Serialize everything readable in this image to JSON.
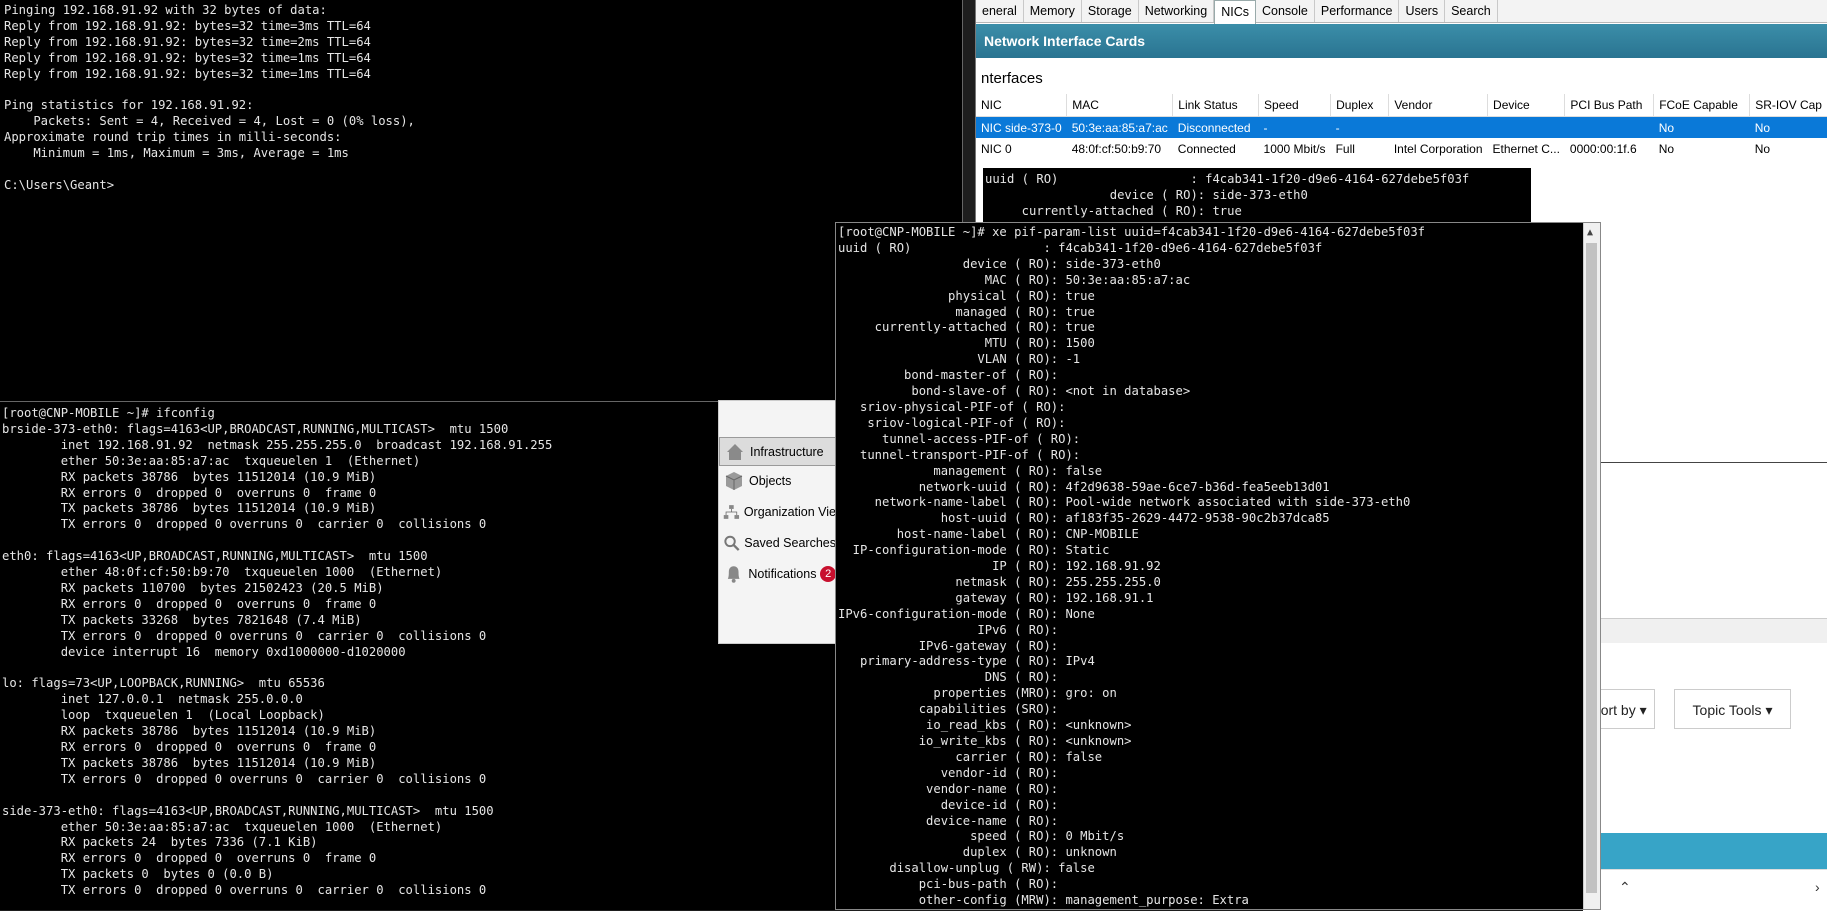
{
  "ping_terminal": {
    "lines": [
      "Pinging 192.168.91.92 with 32 bytes of data:",
      "Reply from 192.168.91.92: bytes=32 time=3ms TTL=64",
      "Reply from 192.168.91.92: bytes=32 time=2ms TTL=64",
      "Reply from 192.168.91.92: bytes=32 time=1ms TTL=64",
      "Reply from 192.168.91.92: bytes=32 time=1ms TTL=64",
      "",
      "Ping statistics for 192.168.91.92:",
      "    Packets: Sent = 4, Received = 4, Lost = 0 (0% loss),",
      "Approximate round trip times in milli-seconds:",
      "    Minimum = 1ms, Maximum = 3ms, Average = 1ms",
      "",
      "C:\\Users\\Geant>"
    ]
  },
  "ifconfig_terminal": {
    "lines": [
      "[root@CNP-MOBILE ~]# ifconfig",
      "brside-373-eth0: flags=4163<UP,BROADCAST,RUNNING,MULTICAST>  mtu 1500",
      "        inet 192.168.91.92  netmask 255.255.255.0  broadcast 192.168.91.255",
      "        ether 50:3e:aa:85:a7:ac  txqueuelen 1  (Ethernet)",
      "        RX packets 38786  bytes 11512014 (10.9 MiB)",
      "        RX errors 0  dropped 0  overruns 0  frame 0",
      "        TX packets 38786  bytes 11512014 (10.9 MiB)",
      "        TX errors 0  dropped 0 overruns 0  carrier 0  collisions 0",
      "",
      "eth0: flags=4163<UP,BROADCAST,RUNNING,MULTICAST>  mtu 1500",
      "        ether 48:0f:cf:50:b9:70  txqueuelen 1000  (Ethernet)",
      "        RX packets 110700  bytes 21502423 (20.5 MiB)",
      "        RX errors 0  dropped 0  overruns 0  frame 0",
      "        TX packets 33268  bytes 7821648 (7.4 MiB)",
      "        TX errors 0  dropped 0 overruns 0  carrier 0  collisions 0",
      "        device interrupt 16  memory 0xd1000000-d1020000",
      "",
      "lo: flags=73<UP,LOOPBACK,RUNNING>  mtu 65536",
      "        inet 127.0.0.1  netmask 255.0.0.0",
      "        loop  txqueuelen 1  (Local Loopback)",
      "        RX packets 38786  bytes 11512014 (10.9 MiB)",
      "        RX errors 0  dropped 0  overruns 0  frame 0",
      "        TX packets 38786  bytes 11512014 (10.9 MiB)",
      "        TX errors 0  dropped 0 overruns 0  carrier 0  collisions 0",
      "",
      "side-373-eth0: flags=4163<UP,BROADCAST,RUNNING,MULTICAST>  mtu 1500",
      "        ether 50:3e:aa:85:a7:ac  txqueuelen 1000  (Ethernet)",
      "        RX packets 24  bytes 7336 (7.1 KiB)",
      "        RX errors 0  dropped 0  overruns 0  frame 0",
      "        TX packets 0  bytes 0 (0.0 B)",
      "        TX errors 0  dropped 0 overruns 0  carrier 0  collisions 0"
    ]
  },
  "pif_terminal": {
    "lines": [
      "[root@CNP-MOBILE ~]# xe pif-param-list uuid=f4cab341-1f20-d9e6-4164-627debe5f03f",
      "uuid ( RO)                  : f4cab341-1f20-d9e6-4164-627debe5f03f",
      "                 device ( RO): side-373-eth0",
      "                    MAC ( RO): 50:3e:aa:85:a7:ac",
      "               physical ( RO): true",
      "                managed ( RO): true",
      "     currently-attached ( RO): true",
      "                    MTU ( RO): 1500",
      "                   VLAN ( RO): -1",
      "         bond-master-of ( RO):",
      "          bond-slave-of ( RO): <not in database>",
      "   sriov-physical-PIF-of ( RO):",
      "    sriov-logical-PIF-of ( RO):",
      "      tunnel-access-PIF-of ( RO):",
      "   tunnel-transport-PIF-of ( RO):",
      "             management ( RO): false",
      "           network-uuid ( RO): 4f2d9638-59ae-6ce7-b36d-fea5eeb13d01",
      "     network-name-label ( RO): Pool-wide network associated with side-373-eth0",
      "              host-uuid ( RO): af183f35-2629-4472-9538-90c2b37dca85",
      "        host-name-label ( RO): CNP-MOBILE",
      "  IP-configuration-mode ( RO): Static",
      "                     IP ( RO): 192.168.91.92",
      "                netmask ( RO): 255.255.255.0",
      "                gateway ( RO): 192.168.91.1",
      "IPv6-configuration-mode ( RO): None",
      "                   IPv6 ( RO):",
      "           IPv6-gateway ( RO):",
      "   primary-address-type ( RO): IPv4",
      "                    DNS ( RO):",
      "             properties (MRO): gro: on",
      "           capabilities (SRO):",
      "            io_read_kbs ( RO): <unknown>",
      "           io_write_kbs ( RO): <unknown>",
      "                carrier ( RO): false",
      "              vendor-id ( RO):",
      "            vendor-name ( RO):",
      "              device-id ( RO):",
      "            device-name ( RO):",
      "                  speed ( RO): 0 Mbit/s",
      "                 duplex ( RO): unknown",
      "       disallow-unplug ( RW): false",
      "           pci-bus-path ( RO):",
      "           other-config (MRW): management_purpose: Extra"
    ]
  },
  "small_terminal": {
    "lines": [
      "uuid ( RO)                  : f4cab341-1f20-d9e6-4164-627debe5f03f",
      "                 device ( RO): side-373-eth0",
      "     currently-attached ( RO): true"
    ]
  },
  "xencenter": {
    "tabs": [
      "eneral",
      "Memory",
      "Storage",
      "Networking",
      "NICs",
      "Console",
      "Performance",
      "Users",
      "Search"
    ],
    "active_tab": "NICs",
    "banner_title": "Network Interface Cards",
    "section_title": "nterfaces",
    "columns": [
      "NIC",
      "MAC",
      "Link Status",
      "Speed",
      "Duplex",
      "Vendor",
      "Device",
      "PCI Bus Path",
      "FCoE Capable",
      "SR-IOV Cap"
    ],
    "rows": [
      [
        "NIC side-373-0",
        "50:3e:aa:85:a7:ac",
        "Disconnected",
        "-",
        "-",
        "",
        "",
        "",
        "No",
        "No"
      ],
      [
        "NIC 0",
        "48:0f:cf:50:b9:70",
        "Connected",
        "1000 Mbit/s",
        "Full",
        "Intel Corporation",
        "Ethernet C...",
        "0000:00:1f.6",
        "No",
        "No"
      ]
    ],
    "accent_color": "#0a79d8",
    "banner_color": "#2a7491"
  },
  "vsphere_nav": {
    "items": [
      {
        "label": "Infrastructure",
        "icon": "house-icon"
      },
      {
        "label": "Objects",
        "icon": "cube-icon"
      },
      {
        "label": "Organization Vie",
        "icon": "org-chart-icon"
      },
      {
        "label": "Saved Searches",
        "icon": "magnifier-icon"
      },
      {
        "label": "Notifications",
        "icon": "bell-icon",
        "badge": "2"
      }
    ]
  },
  "web_page": {
    "sort_label": "Sort by",
    "topic_tools_label": "Topic Tools"
  }
}
